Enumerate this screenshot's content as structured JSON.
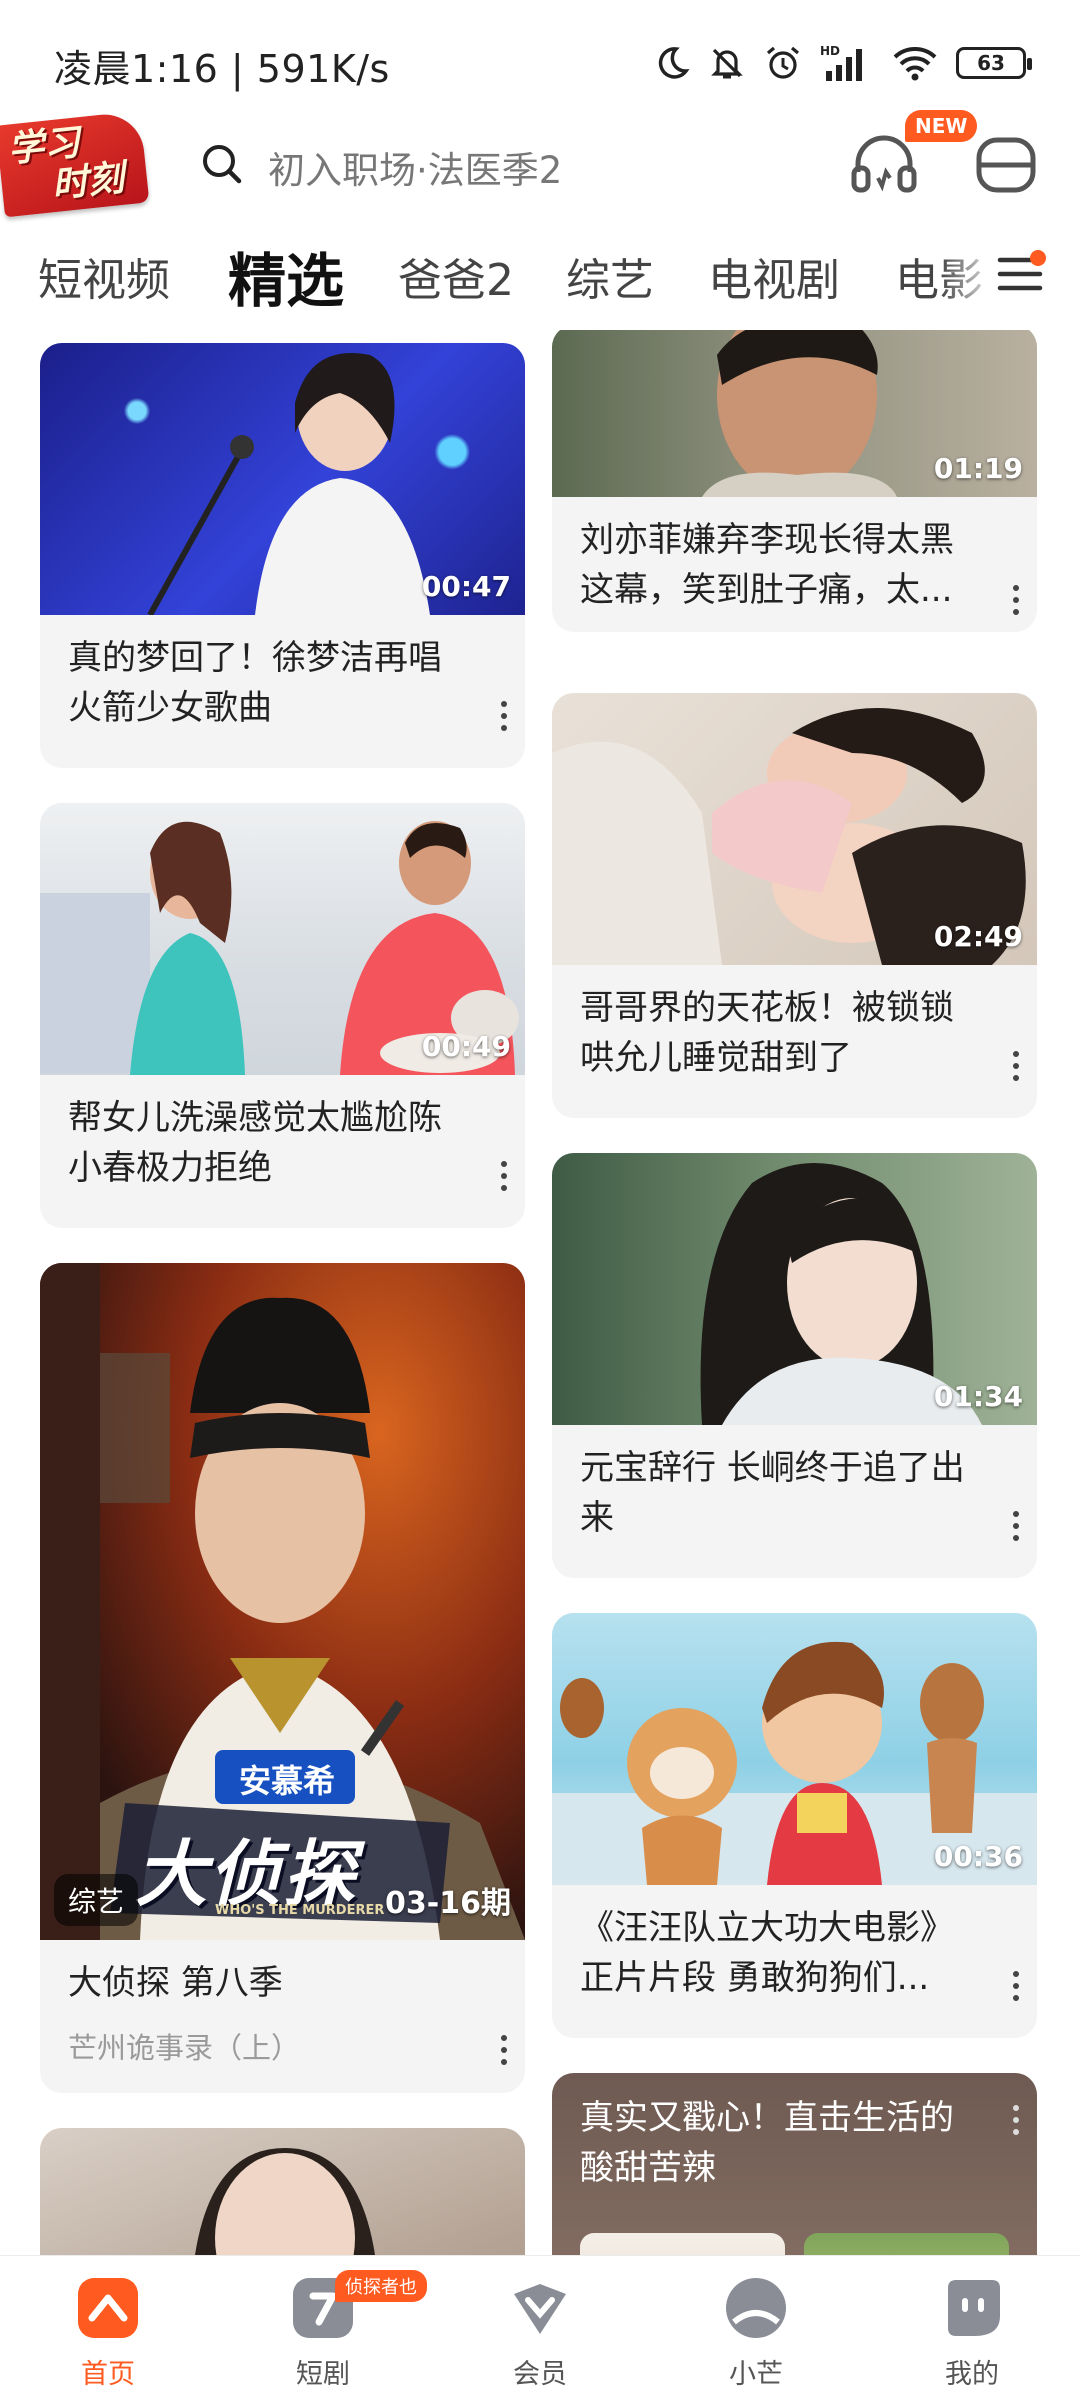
{
  "status_bar": {
    "time": "凌晨1:16 | 591K/s",
    "battery": "63",
    "icons": [
      "moon-icon",
      "mute-bell-icon",
      "alarm-icon",
      "hd-signal-icon",
      "wifi-icon",
      "battery-icon"
    ]
  },
  "header": {
    "logo_line1": "学习",
    "logo_line2": "时刻",
    "search_placeholder": "初入职场·法医季2",
    "new_badge": "NEW",
    "accent_color": "#ff5a1f"
  },
  "tabs": [
    {
      "label": "短视频"
    },
    {
      "label": "精选"
    },
    {
      "label": "爸爸2"
    },
    {
      "label": "综艺"
    },
    {
      "label": "电视剧"
    },
    {
      "label": "电影"
    }
  ],
  "feed": {
    "left": [
      {
        "title": "真的梦回了！徐梦洁再唱火箭少女歌曲",
        "duration": "00:47"
      },
      {
        "title": "帮女儿洗澡感觉太尴尬陈小春极力拒绝",
        "duration": "00:49"
      },
      {
        "title": "大侦探 第八季",
        "subtitle": "芒州诡事录（上）",
        "tag": "综艺",
        "episode": "03-16期",
        "poster_brand": "安慕希",
        "poster_title": "大侦探",
        "poster_sub": "WHO'S THE MURDERER"
      }
    ],
    "right": [
      {
        "title": "刘亦菲嫌弃李现长得太黑这幕，笑到肚子痛，太...",
        "duration": "01:19"
      },
      {
        "title": "哥哥界的天花板！被锁锁哄允儿睡觉甜到了",
        "duration": "02:49"
      },
      {
        "title": "元宝辞行 长峒终于追了出来",
        "duration": "01:34"
      },
      {
        "title": "《汪汪队立大功大电影》正片片段 勇敢狗狗们...",
        "duration": "00:36"
      },
      {
        "title": "真实又戳心！直击生活的酸甜苦辣"
      }
    ]
  },
  "bottom_nav": [
    {
      "label": "首页",
      "active": true
    },
    {
      "label": "短剧",
      "badge": "侦探者也"
    },
    {
      "label": "会员"
    },
    {
      "label": "小芒"
    },
    {
      "label": "我的"
    }
  ]
}
